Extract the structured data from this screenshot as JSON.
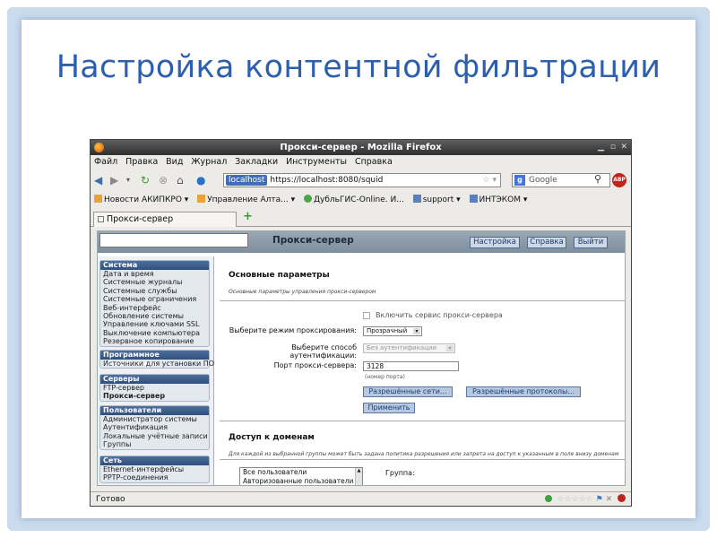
{
  "slide": {
    "title": "Настройка контентной фильтрации"
  },
  "browser": {
    "window_title": "Прокси-сервер - Mozilla Firefox",
    "menu": [
      "Файл",
      "Правка",
      "Вид",
      "Журнал",
      "Закладки",
      "Инструменты",
      "Справка"
    ],
    "url_badge": "localhost",
    "url": "https://localhost:8080/squid",
    "search_engine": "Google",
    "search_placeholder": "Google",
    "bookmarks": [
      "Новости АКИПКРО ▾",
      "Управление Алта... ▾",
      "ДубльГИС-Online. И...",
      "support ▾",
      "ИНТЭКОМ ▾"
    ],
    "tab_label": "Прокси-сервер",
    "status_text": "Готово",
    "abp_label": "ABP"
  },
  "app": {
    "header_title": "Прокси-сервер",
    "header_buttons": [
      "Настройка",
      "Справка",
      "Выйти"
    ],
    "sidebar": [
      {
        "title": "Система",
        "items": [
          "Дата и время",
          "Системные журналы",
          "Системные службы",
          "Системные ограничения",
          "Веб-интерфейс",
          "Обновление системы",
          "Управление ключами SSL",
          "Выключение компьютера",
          "Резервное копирование"
        ]
      },
      {
        "title": "Программное обеспечение",
        "items": [
          "Источники для установки ПО"
        ]
      },
      {
        "title": "Серверы",
        "items": [
          "FTP-сервер",
          "Прокси-сервер"
        ],
        "active": "Прокси-сервер"
      },
      {
        "title": "Пользователи",
        "items": [
          "Администратор системы",
          "Аутентификация",
          "Локальные учётные записи",
          "Группы"
        ]
      },
      {
        "title": "Сеть",
        "items": [
          "Ethernet-интерфейсы",
          "PPTP-соединения"
        ]
      }
    ],
    "main": {
      "section1_title": "Основные параметры",
      "section1_desc": "Основные параметры управления прокси-сервером",
      "enable_label": "Включить сервис прокси-сервера",
      "mode_label": "Выберите режим проксирования:",
      "mode_value": "Прозрачный",
      "auth_label": "Выберите способ аутентификации:",
      "auth_value": "Без аутентификации",
      "port_label": "Порт прокси-сервера:",
      "port_value": "3128",
      "port_hint": "(номер порта)",
      "allowed_networks_button": "Разрешённые сети...",
      "allowed_protocols_button": "Разрешённые протоколы...",
      "apply_button": "Применить",
      "section2_title": "Доступ к доменам",
      "section2_desc": "Для каждой из выбранной группы может быть задана политика разрешения или запрета на доступ к указанным в поле внизу доменам",
      "groups_list": [
        "Все пользователи",
        "Авторизованные пользователи"
      ],
      "group_label": "Группа:"
    }
  }
}
